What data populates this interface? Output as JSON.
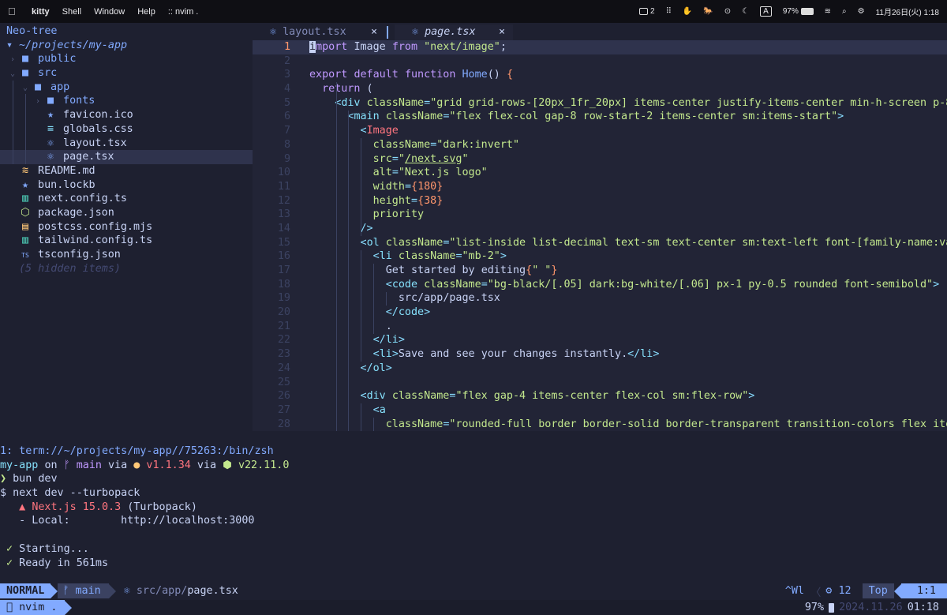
{
  "menubar": {
    "app": "kitty",
    "items": [
      "Shell",
      "Window",
      "Help"
    ],
    "window_title": ":: nvim .",
    "display_count": "2",
    "input_label": "A",
    "battery": "97%",
    "datetime": "11月26日(火) 1:18"
  },
  "tree": {
    "title": "Neo-tree",
    "root": "~/projects/my-app",
    "hidden_note": "(5 hidden items)",
    "entries": [
      {
        "name": "public",
        "type": "dir",
        "depth": 0,
        "open": false
      },
      {
        "name": "src",
        "type": "dir",
        "depth": 0,
        "open": true
      },
      {
        "name": "app",
        "type": "dir",
        "depth": 1,
        "open": true
      },
      {
        "name": "fonts",
        "type": "dir",
        "depth": 2,
        "open": false
      },
      {
        "name": "favicon.ico",
        "type": "file",
        "depth": 2,
        "icon": "star-icon"
      },
      {
        "name": "globals.css",
        "type": "file",
        "depth": 2,
        "icon": "css-icon"
      },
      {
        "name": "layout.tsx",
        "type": "file",
        "depth": 2,
        "icon": "react-icon"
      },
      {
        "name": "page.tsx",
        "type": "file",
        "depth": 2,
        "icon": "react-icon",
        "selected": true
      },
      {
        "name": "README.md",
        "type": "file",
        "depth": 0,
        "icon": "markdown-icon"
      },
      {
        "name": "bun.lockb",
        "type": "file",
        "depth": 0,
        "icon": "star-icon"
      },
      {
        "name": "next.config.ts",
        "type": "file",
        "depth": 0,
        "icon": "ts-config-icon"
      },
      {
        "name": "package.json",
        "type": "file",
        "depth": 0,
        "icon": "npm-icon"
      },
      {
        "name": "postcss.config.mjs",
        "type": "file",
        "depth": 0,
        "icon": "js-icon"
      },
      {
        "name": "tailwind.config.ts",
        "type": "file",
        "depth": 0,
        "icon": "ts-config-icon"
      },
      {
        "name": "tsconfig.json",
        "type": "file",
        "depth": 0,
        "icon": "ts-icon"
      }
    ]
  },
  "tabs": [
    {
      "label": "layout.tsx",
      "active": false
    },
    {
      "label": "page.tsx",
      "active": true
    }
  ],
  "code": {
    "current_line": 1,
    "lines": [
      "import Image from \"next/image\";",
      "",
      "export default function Home() {",
      "  return (",
      "    <div className=\"grid grid-rows-[20px_1fr_20px] items-center justify-items-center min-h-screen p-8",
      "      <main className=\"flex flex-col gap-8 row-start-2 items-center sm:items-start\">",
      "        <Image",
      "          className=\"dark:invert\"",
      "          src=\"/next.svg\"",
      "          alt=\"Next.js logo\"",
      "          width={180}",
      "          height={38}",
      "          priority",
      "        />",
      "        <ol className=\"list-inside list-decimal text-sm text-center sm:text-left font-[family-name:va",
      "          <li className=\"mb-2\">",
      "            Get started by editing{\" \"}",
      "            <code className=\"bg-black/[.05] dark:bg-white/[.06] px-1 py-0.5 rounded font-semibold\">",
      "              src/app/page.tsx",
      "            </code>",
      "            .",
      "          </li>",
      "          <li>Save and see your changes instantly.</li>",
      "        </ol>",
      "",
      "        <div className=\"flex gap-4 items-center flex-col sm:flex-row\">",
      "          <a",
      "            className=\"rounded-full border border-solid border-transparent transition-colors flex ite"
    ]
  },
  "terminal": {
    "title": "1: term://~/projects/my-app//75263:/bin/zsh",
    "prompt_dir": "my-app",
    "prompt_on": "on",
    "prompt_branch": "main",
    "prompt_via": "via",
    "bun_version": "v1.1.34",
    "node_version": "v22.11.0",
    "cmd_prompt": "❯",
    "cmd": "bun dev",
    "lines": [
      "$ next dev --turbopack",
      "   ▲ Next.js 15.0.3 (Turbopack)",
      "   - Local:        http://localhost:3000",
      "",
      " ✓ Starting...",
      " ✓ Ready in 561ms"
    ]
  },
  "statusline": {
    "mode": "NORMAL",
    "branch": "main",
    "path_dir": "src/app/",
    "path_file": "page.tsx",
    "wl": "^Wl",
    "lsp_count": "12",
    "scroll": "Top",
    "position": "1:1"
  },
  "tmux": {
    "window": "nvim .",
    "battery": "97%",
    "date": "2024.11.26",
    "time": "01:18"
  },
  "colors": {
    "accent": "#82aaff",
    "background": "#222436",
    "keyword": "#c099ff",
    "string": "#c3e88d",
    "tag": "#ff757f"
  }
}
